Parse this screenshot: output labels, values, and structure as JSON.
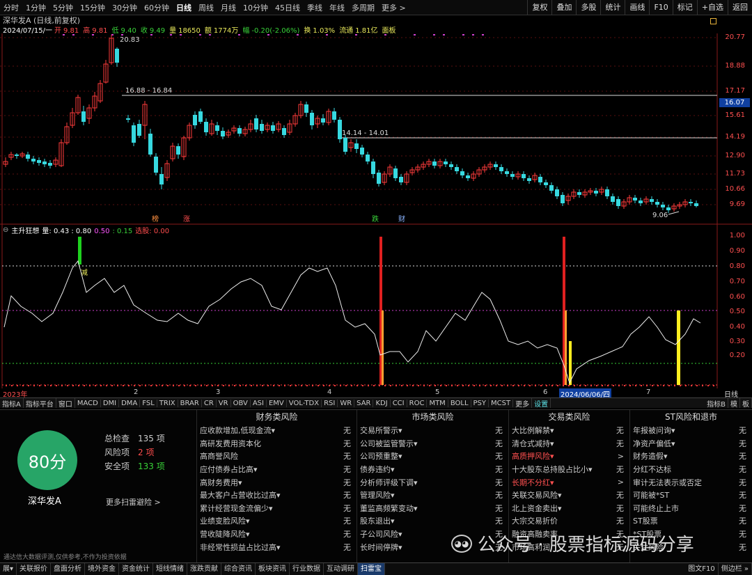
{
  "toolbar": {
    "periods": [
      "分时",
      "1分钟",
      "5分钟",
      "15分钟",
      "30分钟",
      "60分钟",
      "日线",
      "周线",
      "月线",
      "10分钟",
      "45日线",
      "季线",
      "年线",
      "多周期",
      "更多 >"
    ],
    "active_period": "日线",
    "tools": [
      "复权",
      "叠加",
      "多股",
      "统计",
      "画线",
      "F10",
      "标记",
      "+自选",
      "返回"
    ]
  },
  "header": {
    "title": "深华发A (日线,前复权)",
    "date": "2024/07/15/一",
    "open_label": "开",
    "open": "9.81",
    "high_label": "高",
    "high": "9.81",
    "low_label": "低",
    "low": "9.40",
    "close_label": "收",
    "close": "9.49",
    "vol_label": "量",
    "vol": "18650",
    "amt_label": "额",
    "amt": "1774万",
    "chg_label": "幅",
    "chg": "-0.20(-2.06%)",
    "turnover_label": "换",
    "turnover": "1.03%",
    "float_label": "流通",
    "float": "1.81亿",
    "panel_label": "面板"
  },
  "price_axis": [
    "20.77",
    "18.88",
    "17.17",
    "15.61",
    "14.19",
    "12.90",
    "11.73",
    "10.66",
    "9.69"
  ],
  "current_price_tag": "16.07",
  "annotations": {
    "high_label": "20.83",
    "line1_label": "16.88 - 16.84",
    "line2_label": "14.14 - 14.01",
    "low_label": "9.06",
    "events": [
      "榜",
      "涨",
      "跌",
      "财"
    ]
  },
  "indicator": {
    "name": "主升狂想",
    "params": [
      {
        "label": "量: 0.43 : 0.80",
        "color": "#ffffff"
      },
      {
        "label": "0.50",
        "color": "#ff55ff"
      },
      {
        "label": ": 0.15",
        "color": "#39d239"
      },
      {
        "label": "选股: 0.00",
        "color": "#ff4d4d"
      }
    ],
    "buy_label": "减",
    "axis": [
      "1.00",
      "0.90",
      "0.80",
      "0.70",
      "0.60",
      "0.50",
      "0.40",
      "0.30",
      "0.20"
    ]
  },
  "timeline": {
    "labels": [
      "2023年",
      "2",
      "3",
      "4",
      "5",
      "6",
      "7"
    ],
    "cursor_date": "2024/06/06/四",
    "period_button": "日线"
  },
  "indicator_tabs": [
    "指标A",
    "指标平台",
    "窗口",
    "MACD",
    "DMI",
    "DMA",
    "FSL",
    "TRIX",
    "BRAR",
    "CR",
    "VR",
    "OBV",
    "ASI",
    "EMV",
    "VOL-TDX",
    "RSI",
    "WR",
    "SAR",
    "KDJ",
    "CCI",
    "ROC",
    "MTM",
    "BOLL",
    "PSY",
    "MCST",
    "更多",
    "设置"
  ],
  "indicator_tabs_right": [
    "指标B",
    "模",
    "板"
  ],
  "risk": {
    "score": "80分",
    "stock_name": "深华发A",
    "total_label": "总检查",
    "total_value": "135 项",
    "risk_label": "风险项",
    "risk_value": "2 项",
    "safe_label": "安全项",
    "safe_value": "133 项",
    "more_scan": "更多扫雷避险 >",
    "disclaimer": "通达信大数据评测,仅供参考,不作为投资依据",
    "columns": [
      {
        "title": "财务类风险",
        "items": [
          {
            "name": "应收款增加,低现金流▾",
            "value": "无"
          },
          {
            "name": "高研发费用资本化",
            "value": "无"
          },
          {
            "name": "高商誉风险",
            "value": "无"
          },
          {
            "name": "应付债券占比高▾",
            "value": "无"
          },
          {
            "name": "高财务费用▾",
            "value": "无"
          },
          {
            "name": "最大客户占营收比过高▾",
            "value": "无"
          },
          {
            "name": "累计经营现金流偏少▾",
            "value": "无"
          },
          {
            "name": "业绩变脸风险▾",
            "value": "无"
          },
          {
            "name": "营收陡降风险▾",
            "value": "无"
          },
          {
            "name": "非经常性损益占比过高▾",
            "value": "无"
          }
        ]
      },
      {
        "title": "市场类风险",
        "items": [
          {
            "name": "交易所警示▾",
            "value": "无"
          },
          {
            "name": "公司被监管警示▾",
            "value": "无"
          },
          {
            "name": "公司预重整▾",
            "value": "无"
          },
          {
            "name": "债券违约▾",
            "value": "无"
          },
          {
            "name": "分析师评级下调▾",
            "value": "无"
          },
          {
            "name": "管理风险▾",
            "value": "无"
          },
          {
            "name": "董监高频繁变动▾",
            "value": "无"
          },
          {
            "name": "股东退出▾",
            "value": "无"
          },
          {
            "name": "子公司风险▾",
            "value": "无"
          },
          {
            "name": "长时间停牌▾",
            "value": "无"
          }
        ]
      },
      {
        "title": "交易类风险",
        "items": [
          {
            "name": "大比例解禁▾",
            "value": "无"
          },
          {
            "name": "清仓式减持▾",
            "value": "无"
          },
          {
            "name": "高质押风险▾",
            "value": ">",
            "warn": true
          },
          {
            "name": "十大股东总持股占比小▾",
            "value": "无"
          },
          {
            "name": "长期不分红▾",
            "value": ">",
            "warn": true
          },
          {
            "name": "关联交易风险▾",
            "value": "无"
          },
          {
            "name": "北上资金卖出▾",
            "value": "无"
          },
          {
            "name": "大宗交易折价",
            "value": "无"
          },
          {
            "name": "融资高融卖率",
            "value": "无"
          },
          {
            "name": "市场高利润",
            "value": "无"
          }
        ]
      },
      {
        "title": "ST风险和退市",
        "items": [
          {
            "name": "年报被问询▾",
            "value": "无"
          },
          {
            "name": "净资产偏低▾",
            "value": "无"
          },
          {
            "name": "财务造假▾",
            "value": "无"
          },
          {
            "name": "分红不达标",
            "value": "无"
          },
          {
            "name": "审计无法表示或否定",
            "value": "无"
          },
          {
            "name": "可能被*ST",
            "value": "无"
          },
          {
            "name": "可能终止上市",
            "value": "无"
          },
          {
            "name": "ST股票",
            "value": "无"
          },
          {
            "name": "*ST股票",
            "value": "无"
          },
          {
            "name": "关注风险",
            "value": "无"
          }
        ]
      }
    ]
  },
  "watermark": "公众号 · 股票指标源码分享",
  "status_bar": [
    "展▾",
    "关联报价",
    "盘面分析",
    "境外资金",
    "资金统计",
    "短线情绪",
    "涨跌贡献",
    "综合资讯",
    "板块资讯",
    "行业数据",
    "互动调研",
    "扫雷宝"
  ],
  "status_bar_right": [
    "图文F10",
    "侧边栏 »"
  ]
}
